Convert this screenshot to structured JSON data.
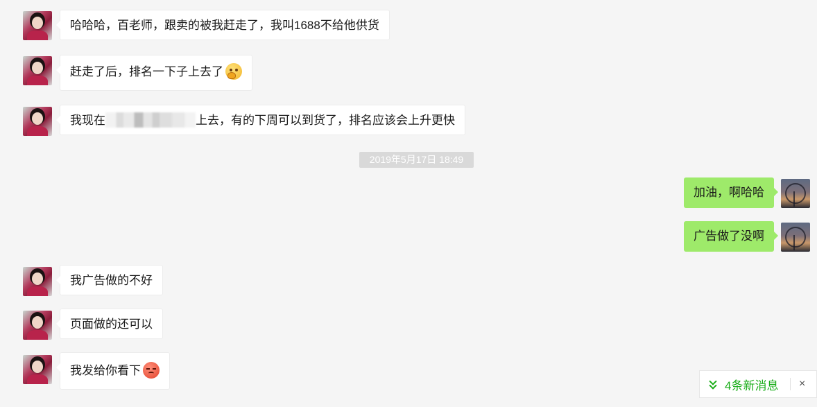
{
  "timestamp": "2019年5月17日 18:49",
  "messages": [
    {
      "side": "in",
      "text": "哈哈哈，百老师，跟卖的被我赶走了，我叫1688不给他供货"
    },
    {
      "side": "in",
      "text": "赶走了后，排名一下子上去了",
      "emoji": "thinking-face-icon"
    },
    {
      "side": "in",
      "text_before": "我现在",
      "text_after": "上去，有的下周可以到货了，排名应该会上升更快"
    },
    {
      "side": "out",
      "text": "加油，啊哈哈"
    },
    {
      "side": "out",
      "text": "广告做了没啊"
    },
    {
      "side": "in",
      "text": "我广告做的不好"
    },
    {
      "side": "in",
      "text": "页面做的还可以"
    },
    {
      "side": "in",
      "text": "我发给你看下",
      "emoji": "disappointed-face-icon"
    }
  ],
  "new_messages": {
    "label": "4条新消息",
    "close": "×"
  },
  "colors": {
    "background": "#f5f5f5",
    "incoming_bubble": "#ffffff",
    "outgoing_bubble": "#9eea6a",
    "accent": "#1aad19"
  }
}
